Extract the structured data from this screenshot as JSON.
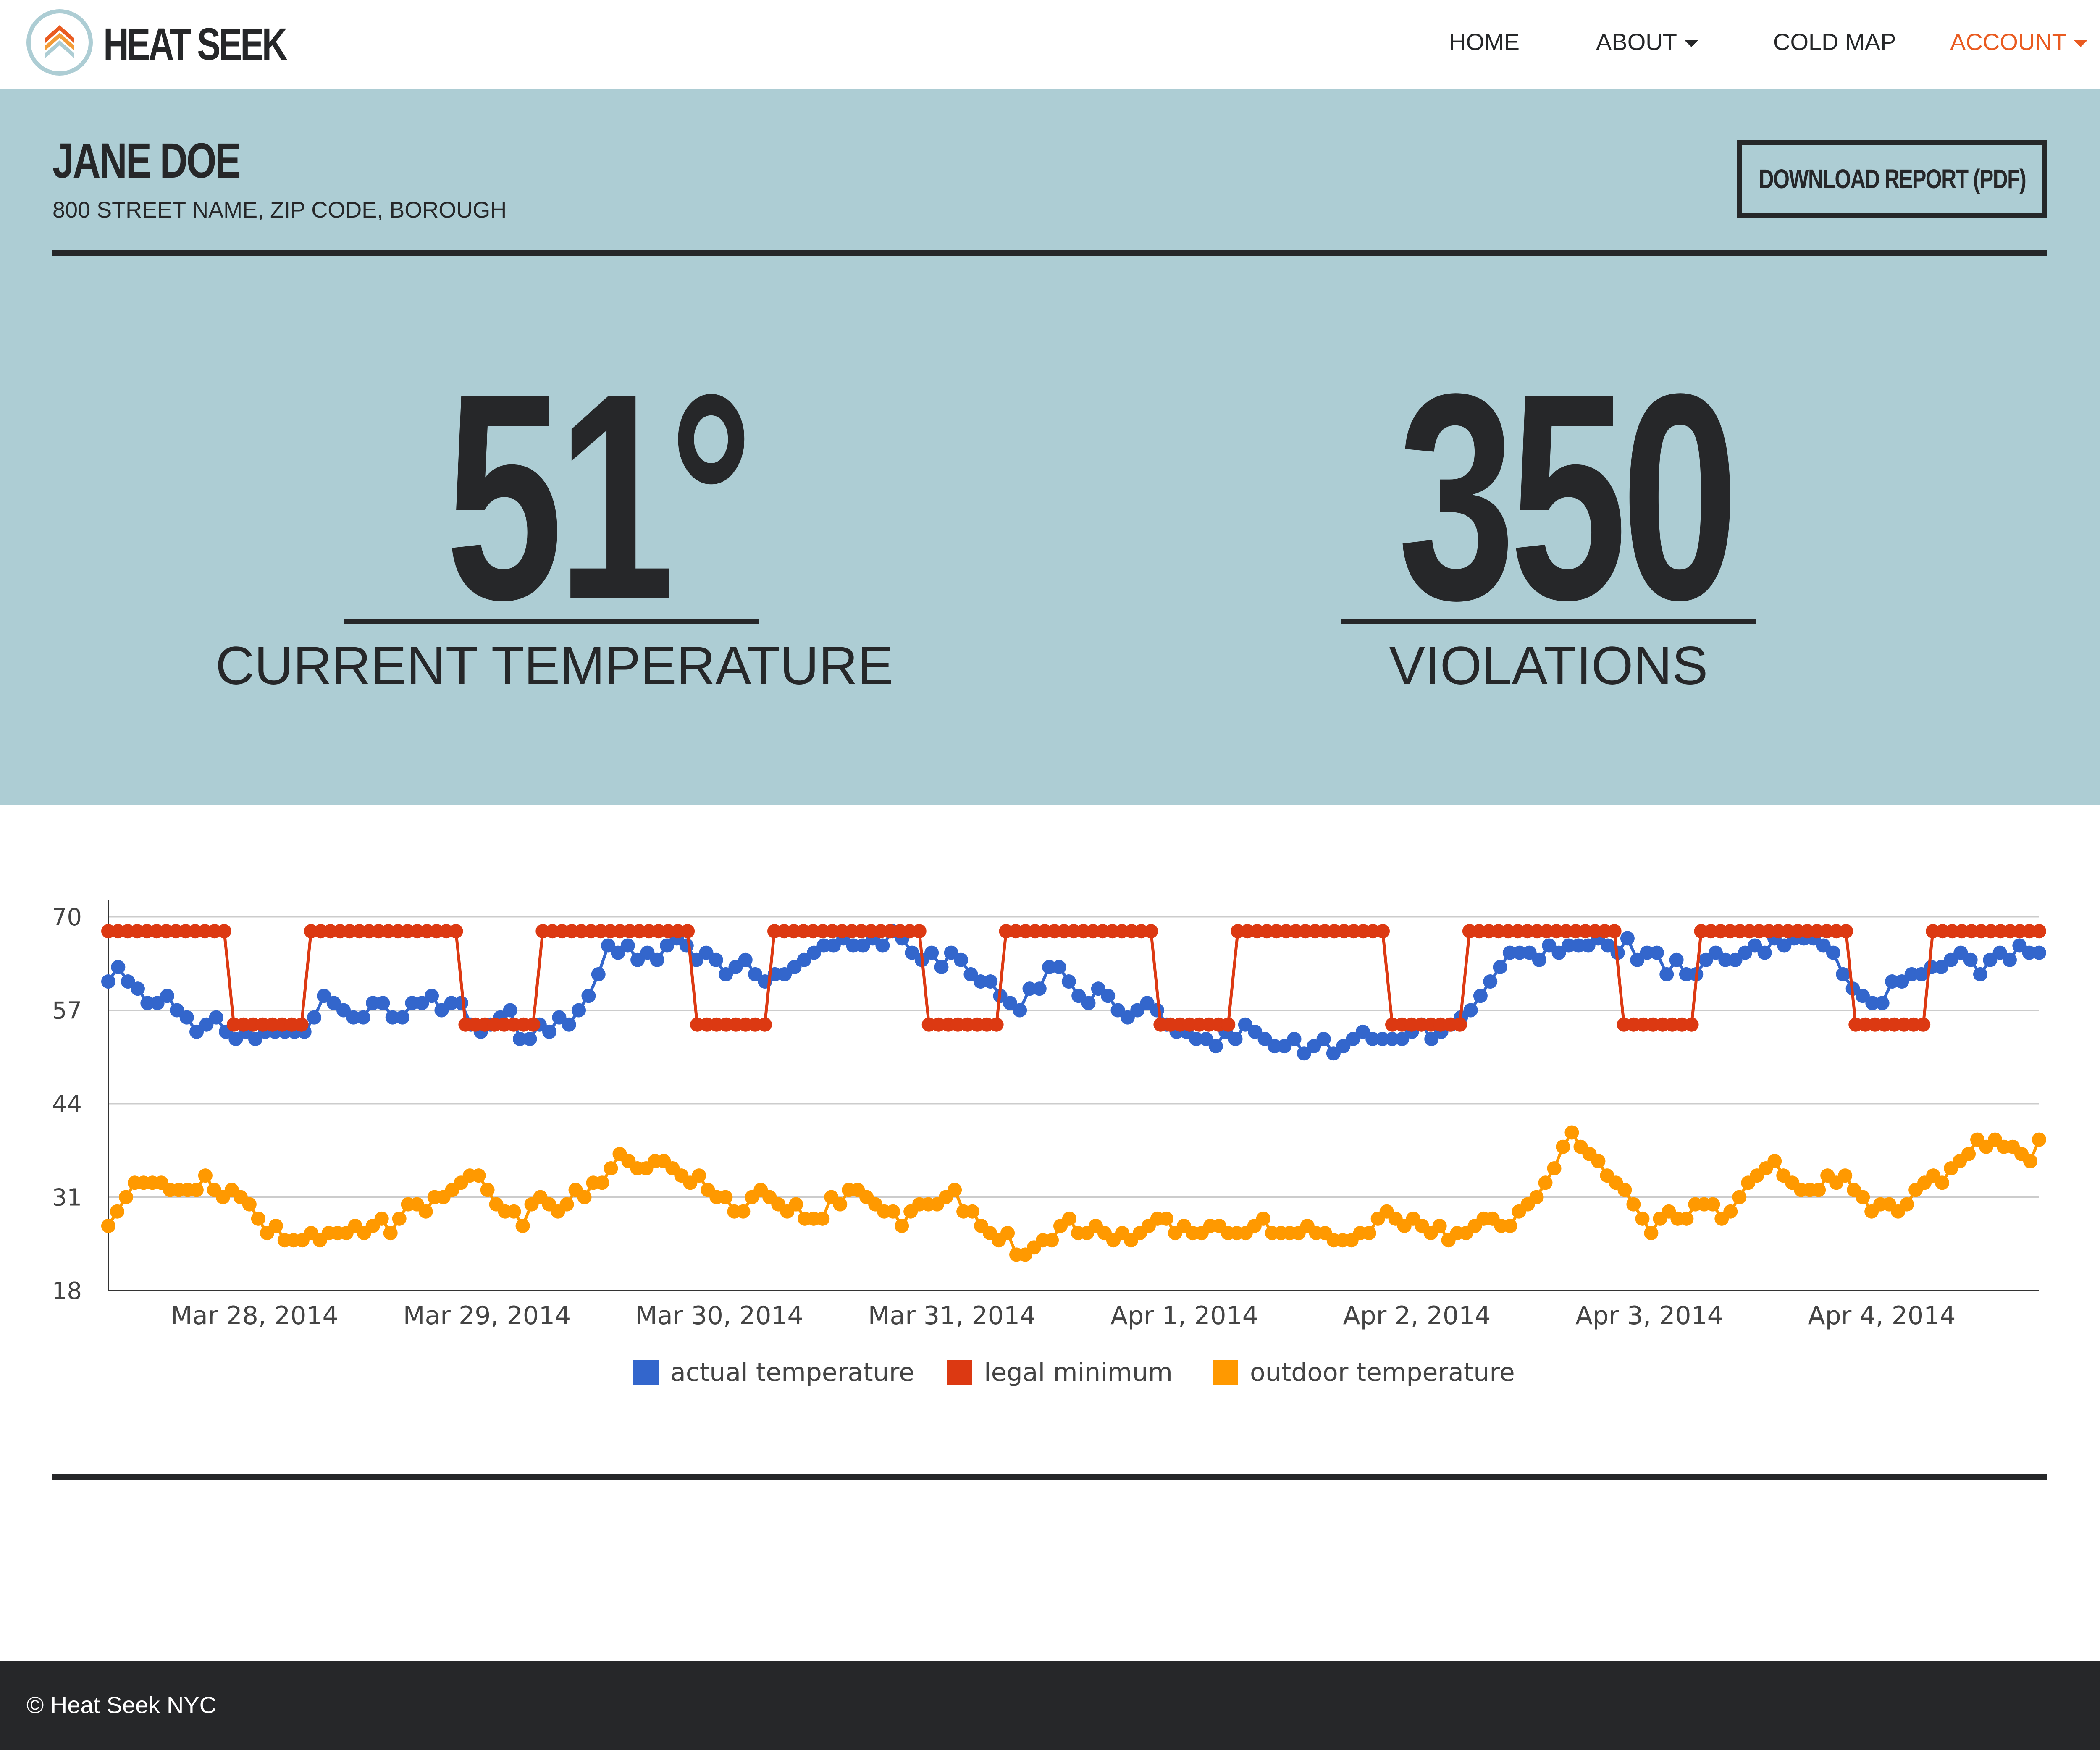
{
  "nav": {
    "brand": "HEAT SEEK",
    "items": [
      {
        "label": "HOME",
        "dropdown": false
      },
      {
        "label": "ABOUT",
        "dropdown": true
      },
      {
        "label": "COLD MAP",
        "dropdown": false
      },
      {
        "label": "ACCOUNT",
        "dropdown": true,
        "active": true
      }
    ]
  },
  "tenant": {
    "name": "JANE DOE",
    "address": "800 STREET NAME, ZIP CODE, BOROUGH"
  },
  "actions": {
    "download_label": "DOWNLOAD REPORT (PDF)"
  },
  "stats": {
    "current_temperature": "51°",
    "current_temperature_label": "CURRENT TEMPERATURE",
    "violations": "350",
    "violations_label": "VIOLATIONS"
  },
  "footer": {
    "copyright": "© Heat Seek NYC"
  },
  "colors": {
    "accent": "#e95b21",
    "hero_bg": "#adcdd4",
    "dark": "#262729",
    "series_actual": "#3366cc",
    "series_legal": "#dc3912",
    "series_outdoor": "#ff9900"
  },
  "chart_data": {
    "type": "line",
    "title": "",
    "xlabel": "",
    "ylabel": "",
    "ylim": [
      18,
      70
    ],
    "yticks": [
      18,
      31,
      44,
      57,
      70
    ],
    "xticks": [
      "Mar 28, 2014",
      "Mar 29, 2014",
      "Mar 30, 2014",
      "Mar 31, 2014",
      "Apr 1, 2014",
      "Apr 2, 2014",
      "Apr 3, 2014",
      "Apr 4, 2014"
    ],
    "legend_position": "bottom",
    "series": [
      {
        "name": "actual temperature",
        "color": "#3366cc",
        "values": [
          61,
          63,
          61,
          60,
          58,
          58,
          59,
          57,
          56,
          54,
          55,
          56,
          54,
          53,
          54,
          53,
          54,
          54,
          54,
          54,
          54,
          56,
          59,
          58,
          57,
          56,
          56,
          58,
          58,
          56,
          56,
          58,
          58,
          59,
          57,
          58,
          58,
          55,
          54,
          55,
          56,
          57,
          53,
          53,
          55,
          54,
          56,
          55,
          57,
          59,
          62,
          66,
          65,
          66,
          64,
          65,
          64,
          66,
          67,
          66,
          64,
          65,
          64,
          62,
          63,
          64,
          62,
          61,
          62,
          62,
          63,
          64,
          65,
          66,
          66,
          67,
          66,
          66,
          67,
          66,
          68,
          67,
          65,
          64,
          65,
          63,
          65,
          64,
          62,
          61,
          61,
          59,
          58,
          57,
          60,
          60,
          63,
          63,
          61,
          59,
          58,
          60,
          59,
          57,
          56,
          57,
          58,
          57,
          55,
          54,
          54,
          53,
          53,
          52,
          54,
          53,
          55,
          54,
          53,
          52,
          52,
          53,
          51,
          52,
          53,
          51,
          52,
          53,
          54,
          53,
          53,
          53,
          53,
          54,
          55,
          53,
          54,
          55,
          56,
          57,
          59,
          61,
          63,
          65,
          65,
          65,
          64,
          66,
          65,
          66,
          66,
          66,
          67,
          66,
          65,
          67,
          64,
          65,
          65,
          62,
          64,
          62,
          62,
          64,
          65,
          64,
          64,
          65,
          66,
          65,
          67,
          66,
          67,
          67,
          67,
          66,
          65,
          62,
          60,
          59,
          58,
          58,
          61,
          61,
          62,
          62,
          63,
          63,
          64,
          65,
          64,
          62,
          64,
          65,
          64,
          66,
          65,
          65
        ]
      },
      {
        "name": "legal minimum",
        "color": "#dc3912",
        "values": [
          68,
          68,
          68,
          68,
          68,
          68,
          68,
          68,
          68,
          68,
          68,
          68,
          68,
          55,
          55,
          55,
          55,
          55,
          55,
          55,
          55,
          68,
          68,
          68,
          68,
          68,
          68,
          68,
          68,
          68,
          68,
          68,
          68,
          68,
          68,
          68,
          68,
          55,
          55,
          55,
          55,
          55,
          55,
          55,
          55,
          68,
          68,
          68,
          68,
          68,
          68,
          68,
          68,
          68,
          68,
          68,
          68,
          68,
          68,
          68,
          68,
          55,
          55,
          55,
          55,
          55,
          55,
          55,
          55,
          68,
          68,
          68,
          68,
          68,
          68,
          68,
          68,
          68,
          68,
          68,
          68,
          68,
          68,
          68,
          68,
          55,
          55,
          55,
          55,
          55,
          55,
          55,
          55,
          68,
          68,
          68,
          68,
          68,
          68,
          68,
          68,
          68,
          68,
          68,
          68,
          68,
          68,
          68,
          68,
          55,
          55,
          55,
          55,
          55,
          55,
          55,
          55,
          68,
          68,
          68,
          68,
          68,
          68,
          68,
          68,
          68,
          68,
          68,
          68,
          68,
          68,
          68,
          68,
          55,
          55,
          55,
          55,
          55,
          55,
          55,
          55,
          68,
          68,
          68,
          68,
          68,
          68,
          68,
          68,
          68,
          68,
          68,
          68,
          68,
          68,
          68,
          68,
          55,
          55,
          55,
          55,
          55,
          55,
          55,
          55,
          68,
          68,
          68,
          68,
          68,
          68,
          68,
          68,
          68,
          68,
          68,
          68,
          68,
          68,
          68,
          68,
          55,
          55,
          55,
          55,
          55,
          55,
          55,
          55,
          68,
          68,
          68,
          68,
          68,
          68,
          68,
          68,
          68,
          68,
          68,
          68
        ]
      },
      {
        "name": "outdoor temperature",
        "color": "#ff9900",
        "values": [
          27,
          29,
          31,
          33,
          33,
          33,
          33,
          32,
          32,
          32,
          32,
          34,
          32,
          31,
          32,
          31,
          30,
          28,
          26,
          27,
          25,
          25,
          25,
          26,
          25,
          26,
          26,
          26,
          27,
          26,
          27,
          28,
          26,
          28,
          30,
          30,
          29,
          31,
          31,
          32,
          33,
          34,
          34,
          32,
          30,
          29,
          29,
          27,
          30,
          31,
          30,
          29,
          30,
          32,
          31,
          33,
          33,
          35,
          37,
          36,
          35,
          35,
          36,
          36,
          35,
          34,
          33,
          34,
          32,
          31,
          31,
          29,
          29,
          31,
          32,
          31,
          30,
          29,
          30,
          28,
          28,
          28,
          31,
          30,
          32,
          32,
          31,
          30,
          29,
          29,
          27,
          29,
          30,
          30,
          30,
          31,
          32,
          29,
          29,
          27,
          26,
          25,
          26,
          23,
          23,
          24,
          25,
          25,
          27,
          28,
          26,
          26,
          27,
          26,
          25,
          26,
          25,
          26,
          27,
          28,
          28,
          26,
          27,
          26,
          26,
          27,
          27,
          26,
          26,
          26,
          27,
          28,
          26,
          26,
          26,
          26,
          27,
          26,
          26,
          25,
          25,
          25,
          26,
          26,
          28,
          29,
          28,
          27,
          28,
          27,
          26,
          27,
          25,
          26,
          26,
          27,
          28,
          28,
          27,
          27,
          29,
          30,
          31,
          33,
          35,
          38,
          40,
          38,
          37,
          36,
          34,
          33,
          32,
          30,
          28,
          26,
          28,
          29,
          28,
          28,
          30,
          30,
          30,
          28,
          29,
          31,
          33,
          34,
          35,
          36,
          34,
          33,
          32,
          32,
          32,
          34,
          33,
          34,
          32,
          31,
          29,
          30,
          30,
          29,
          30,
          32,
          33,
          34,
          33,
          35,
          36,
          37,
          39,
          38,
          39,
          38,
          38,
          37,
          36,
          39
        ]
      }
    ]
  }
}
